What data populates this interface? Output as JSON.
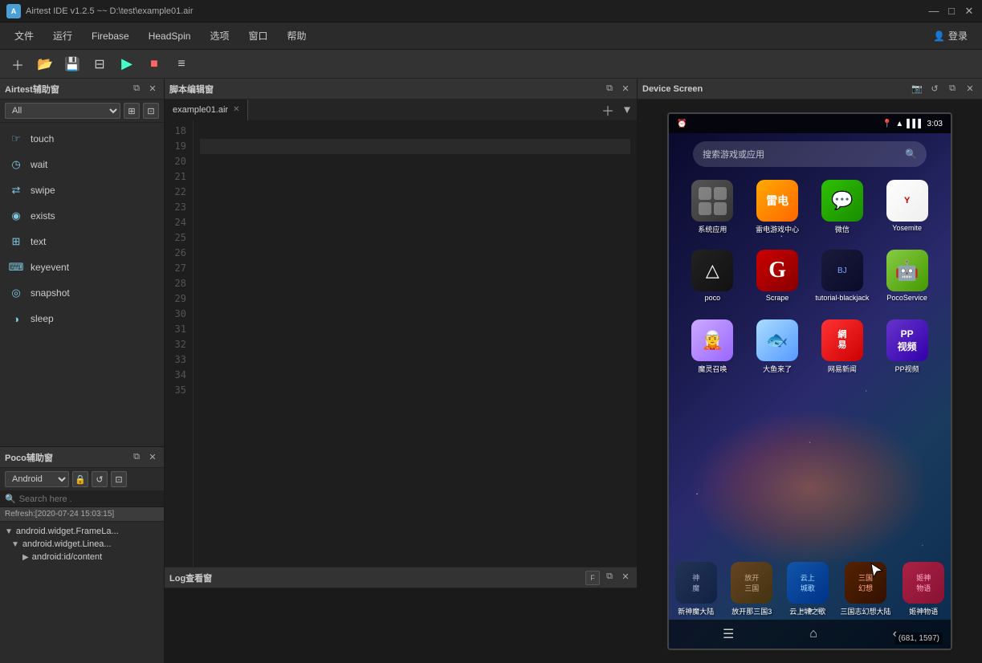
{
  "window": {
    "title": "Airtest IDE v1.2.5 ~~ D:\\test\\example01.air",
    "minimize_label": "—",
    "maximize_label": "□",
    "close_label": "✕"
  },
  "menu": {
    "items": [
      "文件",
      "运行",
      "Firebase",
      "HeadSpin",
      "选项",
      "窗口",
      "帮助"
    ],
    "login_label": "登录"
  },
  "toolbar": {
    "buttons": [
      "＋",
      "📁",
      "💾",
      "⊟",
      "▶",
      "■",
      "≡"
    ]
  },
  "airtest_panel": {
    "title": "Airtest辅助窗",
    "filter_default": "All",
    "apis": [
      {
        "name": "touch",
        "icon": "☞"
      },
      {
        "name": "wait",
        "icon": "◷"
      },
      {
        "name": "swipe",
        "icon": "⇄"
      },
      {
        "name": "exists",
        "icon": "◉"
      },
      {
        "name": "text",
        "icon": "⊞"
      },
      {
        "name": "keyevent",
        "icon": "⌨"
      },
      {
        "name": "snapshot",
        "icon": "◉"
      },
      {
        "name": "sleep",
        "icon": "◑"
      }
    ]
  },
  "editor": {
    "title": "脚本编辑窗",
    "tab_name": "example01.air",
    "line_numbers": [
      18,
      19,
      20,
      21,
      22,
      23,
      24,
      25,
      26,
      27,
      28,
      29,
      30,
      31,
      32,
      33,
      34,
      35
    ]
  },
  "log_panel": {
    "title": "Log查看窗"
  },
  "poco_panel": {
    "title": "Poco辅助窗",
    "platform": "Android",
    "search_placeholder": "Search here .",
    "refresh_label": "Refresh:[2020-07-24 15:03:15]",
    "tree": {
      "root": "android.widget.FrameLa...",
      "child": "android.widget.Linea...",
      "grandchild": "android:id/content"
    }
  },
  "device_screen": {
    "title": "Device Screen",
    "phone": {
      "time": "3:03",
      "search_placeholder": "搜索游戏或应用",
      "apps_row1": [
        {
          "name": "系统应用",
          "type": "sysapp"
        },
        {
          "name": "雷电游戏中心",
          "type": "ld"
        },
        {
          "name": "微信",
          "type": "wechat"
        },
        {
          "name": "Yosemite",
          "type": "yosemite"
        }
      ],
      "apps_row2": [
        {
          "name": "poco",
          "type": "poco"
        },
        {
          "name": "Scrape",
          "type": "scrape"
        },
        {
          "name": "tutorial-blackjack",
          "type": "blackjack"
        },
        {
          "name": "PocoService",
          "type": "pocoservice"
        }
      ],
      "apps_row3": [
        {
          "name": "魔灵召唤",
          "type": "magic"
        },
        {
          "name": "大鱼来了",
          "type": "dayu"
        },
        {
          "name": "网易新闻",
          "type": "wyxw"
        },
        {
          "name": "PP视频",
          "type": "ppvideo"
        }
      ],
      "apps_dock": [
        {
          "name": "新神魔大陆",
          "type": "shenmoda"
        },
        {
          "name": "放开那三国3",
          "type": "fangkai"
        },
        {
          "name": "云上城之歌",
          "type": "yunyue"
        },
        {
          "name": "三国志幻想大陆",
          "type": "sanguo"
        },
        {
          "name": "姬神物语",
          "type": "jiShen"
        }
      ],
      "coords": "(681, 1597)"
    }
  }
}
